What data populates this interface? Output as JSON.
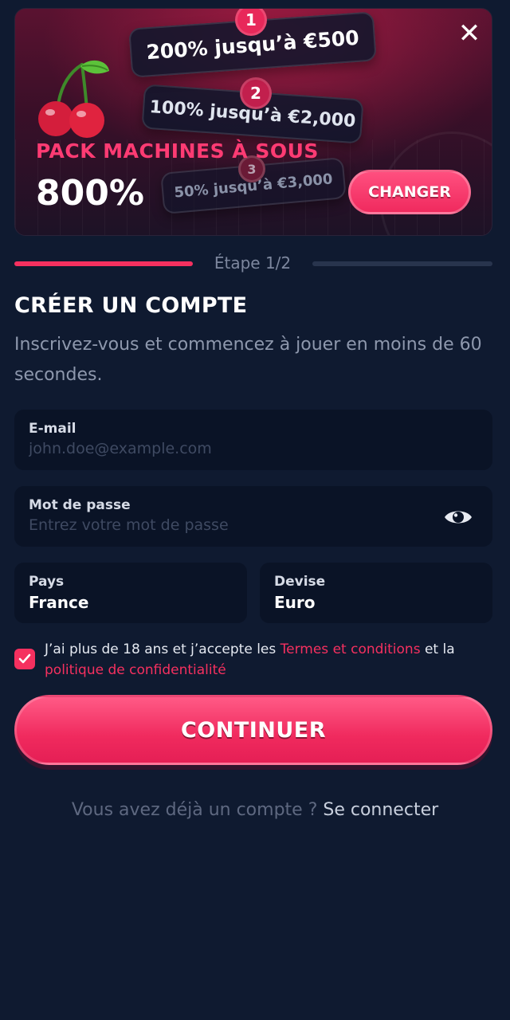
{
  "banner": {
    "tiers": [
      {
        "badge": "1",
        "text": "200% jusqu’à €500"
      },
      {
        "badge": "2",
        "text": "100% jusqu’à €2,000"
      },
      {
        "badge": "3",
        "text": "50% jusqu’à €3,000"
      }
    ],
    "pack_title": "PACK MACHINES À SOUS",
    "pack_percent": "800%",
    "change_button": "CHANGER",
    "close_icon": "close-icon",
    "decor_icon": "cherry-icon"
  },
  "progress": {
    "label": "Étape 1/2",
    "current_step": 1,
    "total_steps": 2
  },
  "form": {
    "title": "CRÉER UN COMPTE",
    "subtitle": "Inscrivez-vous et commencez à jouer en moins de 60 secondes.",
    "email": {
      "label": "E-mail",
      "placeholder": "john.doe@example.com",
      "value": ""
    },
    "password": {
      "label": "Mot de passe",
      "placeholder": "Entrez votre mot de passe",
      "value": "",
      "toggle_icon": "eye-icon"
    },
    "country": {
      "label": "Pays",
      "value": "France"
    },
    "currency": {
      "label": "Devise",
      "value": "Euro"
    },
    "terms": {
      "checked": true,
      "prefix": "J’ai plus de 18 ans et j’accepte les ",
      "terms_link": "Termes et conditions",
      "middle": " et la ",
      "privacy_link": "politique de confidentialité"
    },
    "continue_button": "CONTINUER",
    "login": {
      "prompt": "Vous avez déjà un compte ? ",
      "link": "Se connecter"
    }
  },
  "colors": {
    "background": "#0f1a30",
    "accent": "#f5305f",
    "field_bg": "#0a1326",
    "muted_text": "#8e98ad"
  }
}
